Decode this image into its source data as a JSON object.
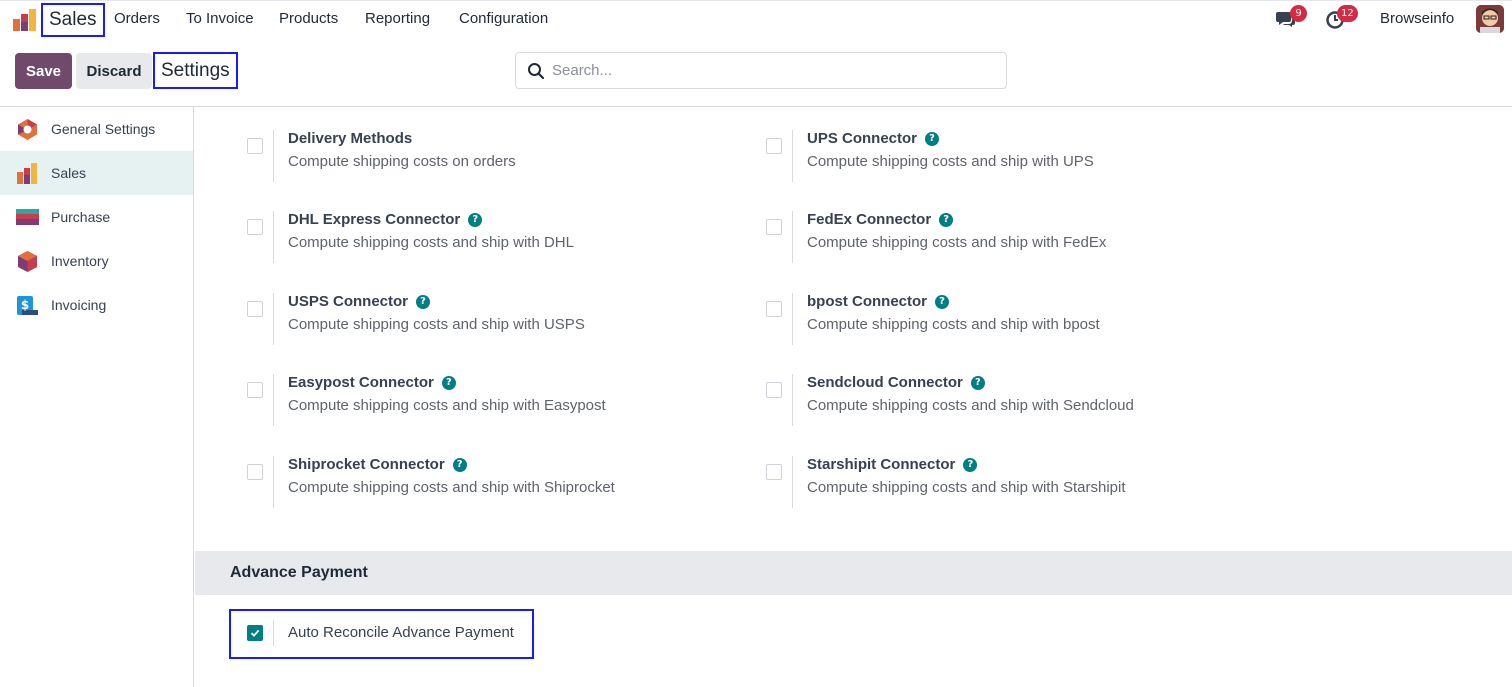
{
  "nav": {
    "app_name": "Sales",
    "menu": [
      "Orders",
      "To Invoice",
      "Products",
      "Reporting",
      "Configuration"
    ],
    "chat_count": "9",
    "activity_count": "12",
    "user": "Browseinfo"
  },
  "control": {
    "save_label": "Save",
    "discard_label": "Discard",
    "breadcrumb": "Settings",
    "search_placeholder": "Search..."
  },
  "sidebar": {
    "items": [
      {
        "label": "General Settings",
        "icon": "general-settings-icon"
      },
      {
        "label": "Sales",
        "icon": "sales-icon",
        "active": true
      },
      {
        "label": "Purchase",
        "icon": "purchase-icon"
      },
      {
        "label": "Inventory",
        "icon": "inventory-icon"
      },
      {
        "label": "Invoicing",
        "icon": "invoicing-icon"
      }
    ]
  },
  "shipping": {
    "left": [
      {
        "title": "Delivery Methods",
        "desc": "Compute shipping costs on orders",
        "help": false
      },
      {
        "title": "DHL Express Connector",
        "desc": "Compute shipping costs and ship with DHL",
        "help": true
      },
      {
        "title": "USPS Connector",
        "desc": "Compute shipping costs and ship with USPS",
        "help": true
      },
      {
        "title": "Easypost Connector",
        "desc": "Compute shipping costs and ship with Easypost",
        "help": true
      },
      {
        "title": "Shiprocket Connector",
        "desc": "Compute shipping costs and ship with Shiprocket",
        "help": true
      }
    ],
    "right": [
      {
        "title": "UPS Connector",
        "desc": "Compute shipping costs and ship with UPS",
        "help": true
      },
      {
        "title": "FedEx Connector",
        "desc": "Compute shipping costs and ship with FedEx",
        "help": true
      },
      {
        "title": "bpost Connector",
        "desc": "Compute shipping costs and ship with bpost",
        "help": true
      },
      {
        "title": "Sendcloud Connector",
        "desc": "Compute shipping costs and ship with Sendcloud",
        "help": true
      },
      {
        "title": "Starshipit Connector",
        "desc": "Compute shipping costs and ship with Starshipit",
        "help": true
      }
    ]
  },
  "advance_payment": {
    "section_title": "Advance Payment",
    "auto_reconcile_label": "Auto Reconcile Advance Payment",
    "auto_reconcile_checked": true
  },
  "colors": {
    "brand": "#71496b",
    "accent": "#017e84",
    "badge": "#d42b45",
    "highlight": "#1a1aff"
  }
}
